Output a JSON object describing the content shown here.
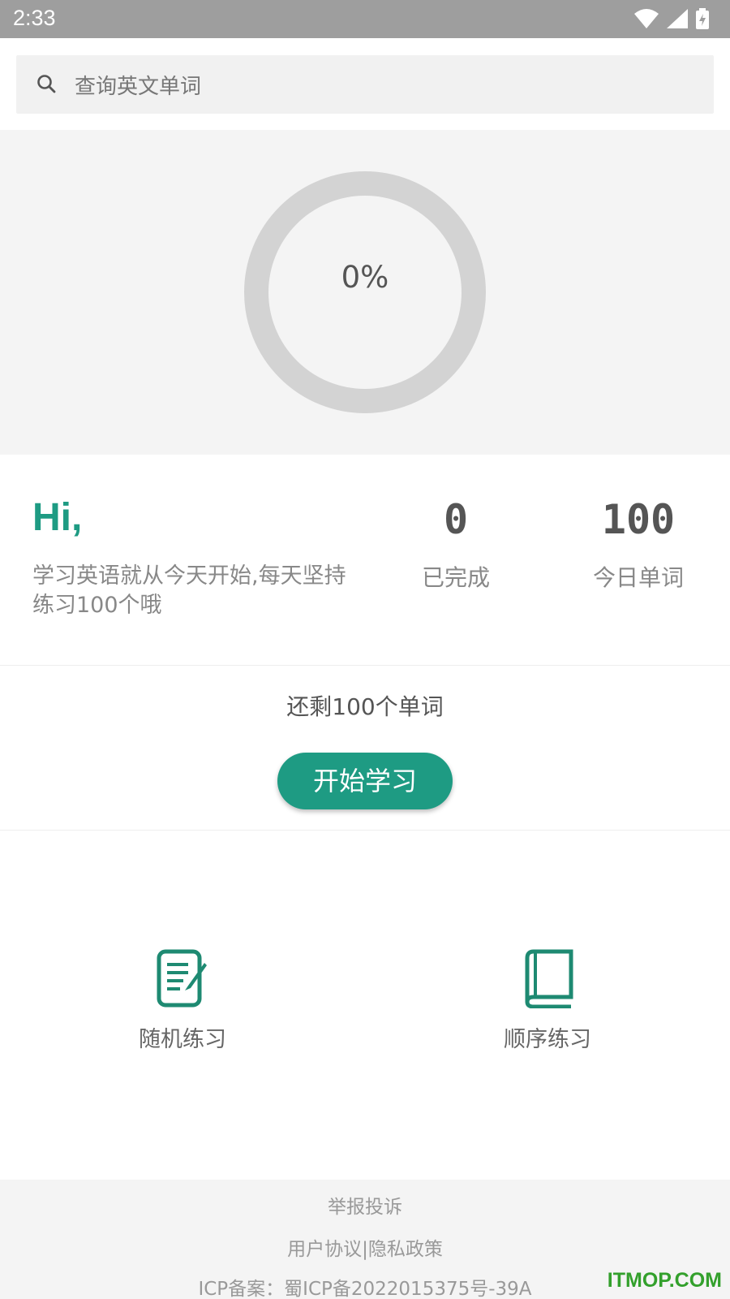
{
  "status_bar": {
    "time": "2:33"
  },
  "search": {
    "placeholder": "查询英文单词"
  },
  "progress": {
    "percent_label": "0%",
    "value": 0
  },
  "greeting": {
    "hi": "Hi,",
    "motto": "学习英语就从今天开始,每天坚持练习100个哦"
  },
  "stats": {
    "completed": {
      "value": "0",
      "label": "已完成"
    },
    "today": {
      "value": "100",
      "label": "今日单词"
    }
  },
  "remaining": {
    "text": "还剩100个单词"
  },
  "start_button": {
    "label": "开始学习"
  },
  "practice": {
    "random": {
      "label": "随机练习",
      "icon": "notepad-pen-icon"
    },
    "order": {
      "label": "顺序练习",
      "icon": "book-icon"
    }
  },
  "footer": {
    "report": "举报投诉",
    "links": "用户协议|隐私政策",
    "icp": "ICP备案：蜀ICP备2022015375号-39A"
  },
  "watermark": "ITMOP.COM",
  "colors": {
    "accent": "#1e9b83",
    "ring": "#d3d3d3",
    "statusbar": "#9e9e9e"
  }
}
